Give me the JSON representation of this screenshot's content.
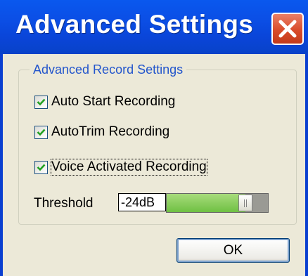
{
  "window": {
    "title": "Advanced Settings"
  },
  "group": {
    "legend": "Advanced Record Settings"
  },
  "checkboxes": [
    {
      "label": "Auto Start Recording",
      "checked": true
    },
    {
      "label": "AutoTrim Recording",
      "checked": true
    },
    {
      "label": "Voice Activated Recording",
      "checked": true,
      "focused": true
    }
  ],
  "threshold": {
    "label": "Threshold",
    "value": "-24dB",
    "level_fraction": 0.78
  },
  "buttons": {
    "ok": "OK"
  },
  "colors": {
    "titlebar": "#0a4fe6",
    "close": "#d94b2a",
    "client": "#ece9d8",
    "legend": "#2255cc",
    "check": "#21a121",
    "slider_fill": "#6fc043"
  },
  "icons": {
    "close": "close-icon",
    "check": "check-icon"
  }
}
